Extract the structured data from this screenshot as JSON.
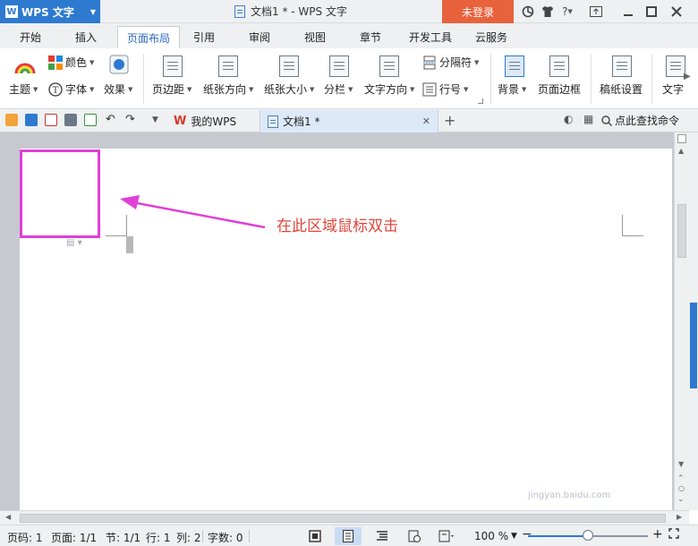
{
  "titlebar": {
    "app_name": "WPS 文字",
    "doc_title": "文档1 * - WPS 文字",
    "login_label": "未登录",
    "help_label": "?"
  },
  "tabs": [
    "开始",
    "插入",
    "页面布局",
    "引用",
    "审阅",
    "视图",
    "章节",
    "开发工具",
    "云服务"
  ],
  "active_tab": "页面布局",
  "ribbon": {
    "color_label": "颜色",
    "theme_label": "主题",
    "font_label": "字体",
    "effect_label": "效果",
    "margin_label": "页边距",
    "orientation_label": "纸张方向",
    "size_label": "纸张大小",
    "columns_label": "分栏",
    "text_direction_label": "文字方向",
    "separator_label": "分隔符",
    "line_number_label": "行号",
    "background_label": "背景",
    "page_border_label": "页面边框",
    "manuscript_label": "稿纸设置",
    "text_more_label": "文字"
  },
  "doc_tabs": {
    "mywps": "我的WPS",
    "doc1": "文档1 *",
    "search_label": "点此查找命令"
  },
  "document": {
    "annotation_text": "在此区域鼠标双击"
  },
  "statusbar": {
    "page": "页码: 1",
    "pages": "页面: 1/1",
    "section": "节: 1/1",
    "row": "行: 1",
    "col": "列: 2",
    "wordcount": "字数: 0",
    "zoom": "100 %",
    "zoom_level": 1.0
  },
  "watermark": "jingyan.baidu.com",
  "colors": {
    "accent": "#2e7ad1",
    "login": "#e8623c",
    "highlight_box": "#e040d8",
    "annotation": "#e0463c"
  }
}
